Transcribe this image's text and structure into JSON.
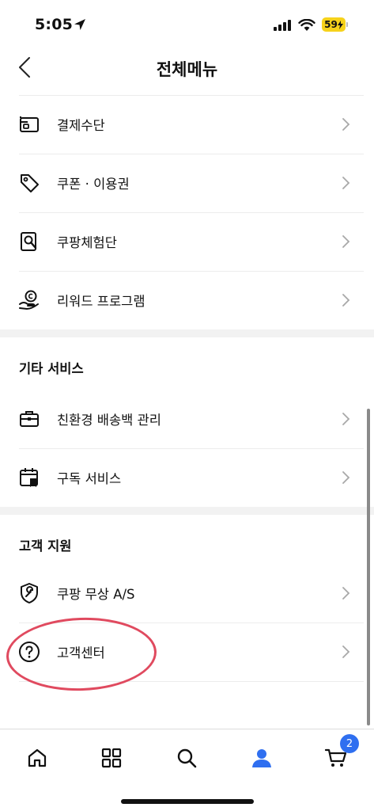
{
  "status_bar": {
    "time": "5:05",
    "battery": "59"
  },
  "header": {
    "title": "전체메뉴"
  },
  "menu_top": [
    {
      "label": "결제수단"
    },
    {
      "label": "쿠폰 · 이용권"
    },
    {
      "label": "쿠팡체험단"
    },
    {
      "label": "리워드 프로그램"
    }
  ],
  "section_other": {
    "title": "기타 서비스",
    "items": [
      {
        "label": "친환경 배송백 관리"
      },
      {
        "label": "구독 서비스"
      }
    ]
  },
  "section_support": {
    "title": "고객 지원",
    "items": [
      {
        "label": "쿠팡 무상 A/S"
      },
      {
        "label": "고객센터"
      }
    ]
  },
  "tab_bar": {
    "items": [
      "home-icon",
      "grid-icon",
      "search-icon",
      "user-icon",
      "cart-icon"
    ],
    "cart_badge": "2",
    "active": "user-icon",
    "accent_color": "#2f6ff0"
  },
  "highlight_color": "#e04a5f"
}
